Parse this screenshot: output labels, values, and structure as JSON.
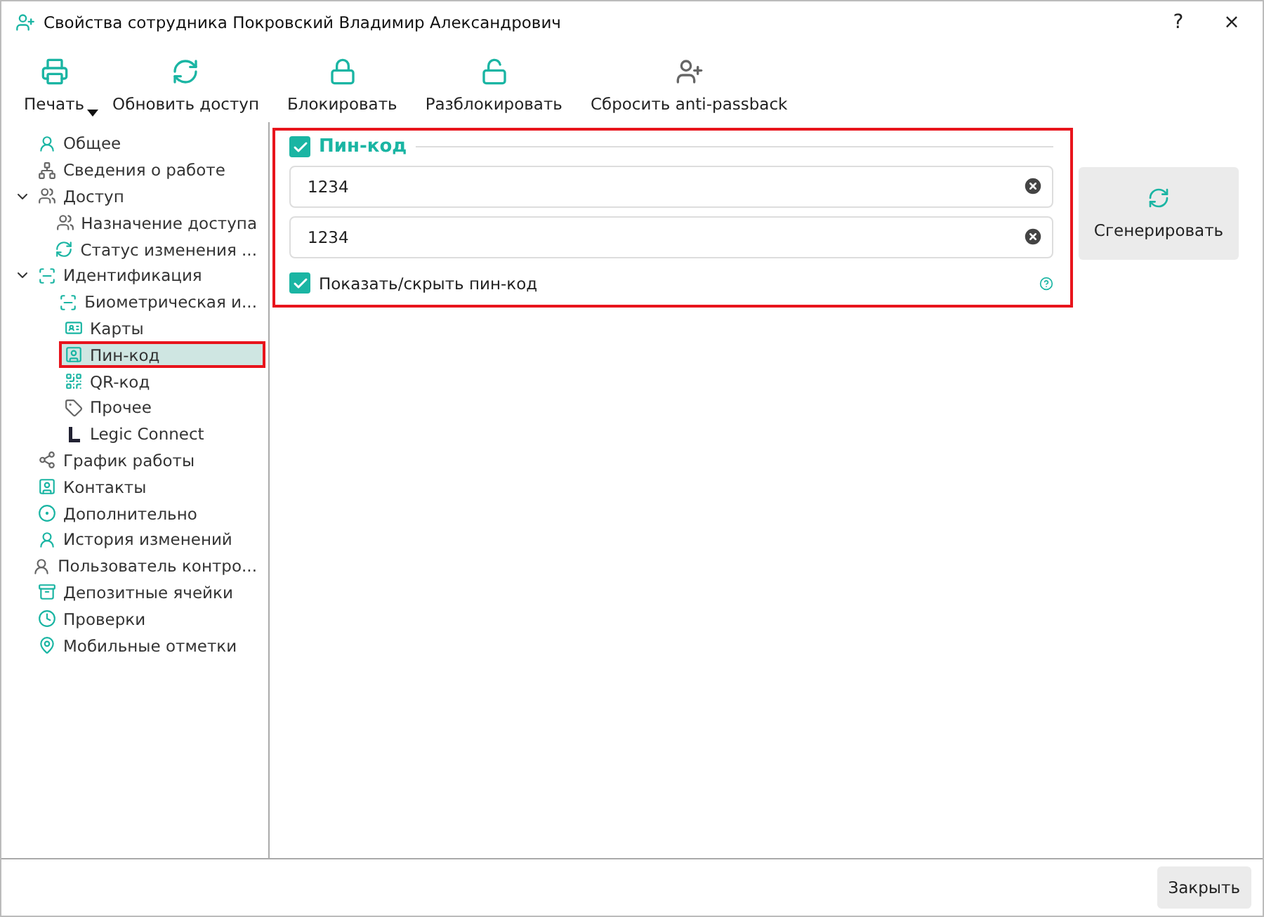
{
  "window": {
    "title": "Свойства сотрудника Покровский Владимир Александрович",
    "help": "?",
    "close": "×"
  },
  "toolbar": [
    {
      "label": "Печать",
      "dropdown": true
    },
    {
      "label": "Обновить доступ",
      "dropdown": false
    },
    {
      "label": "Блокировать",
      "dropdown": false
    },
    {
      "label": "Разблокировать",
      "dropdown": false
    },
    {
      "label": "Сбросить anti-passback",
      "dropdown": false
    }
  ],
  "sidebar": {
    "items": [
      {
        "label": "Общее",
        "selected": false,
        "highlighted": false
      },
      {
        "label": "Сведения о работе",
        "selected": false,
        "highlighted": false
      },
      {
        "label": "Доступ",
        "selected": false,
        "highlighted": false,
        "expanded": true,
        "children": [
          {
            "label": "Назначение доступа",
            "selected": false,
            "highlighted": false
          },
          {
            "label": "Статус изменения ...",
            "selected": false,
            "highlighted": false
          }
        ]
      },
      {
        "label": "Идентификация",
        "selected": false,
        "highlighted": false,
        "expanded": true,
        "children": [
          {
            "label": "Биометрическая и...",
            "selected": false,
            "highlighted": false
          },
          {
            "label": "Карты",
            "selected": false,
            "highlighted": false
          },
          {
            "label": "Пин-код",
            "selected": true,
            "highlighted": true
          },
          {
            "label": "QR-код",
            "selected": false,
            "highlighted": false
          },
          {
            "label": "Прочее",
            "selected": false,
            "highlighted": false
          },
          {
            "label": "Legic Connect",
            "selected": false,
            "highlighted": false
          }
        ]
      },
      {
        "label": "График работы",
        "selected": false,
        "highlighted": false
      },
      {
        "label": "Контакты",
        "selected": false,
        "highlighted": false
      },
      {
        "label": "Дополнительно",
        "selected": false,
        "highlighted": false
      },
      {
        "label": "История изменений",
        "selected": false,
        "highlighted": false
      },
      {
        "label": "Пользователь контро...",
        "selected": false,
        "highlighted": false
      },
      {
        "label": "Депозитные ячейки",
        "selected": false,
        "highlighted": false
      },
      {
        "label": "Проверки",
        "selected": false,
        "highlighted": false
      },
      {
        "label": "Мобильные отметки",
        "selected": false,
        "highlighted": false
      }
    ]
  },
  "pin_section": {
    "title": "Пин-код",
    "checked": true,
    "highlighted": true,
    "fields": [
      {
        "value": "1234"
      },
      {
        "value": "1234"
      }
    ],
    "show_toggle": {
      "label": "Показать/скрыть пин-код",
      "checked": true
    },
    "generate_button": "Сгенерировать"
  },
  "footer": {
    "close_button": "Закрыть"
  }
}
